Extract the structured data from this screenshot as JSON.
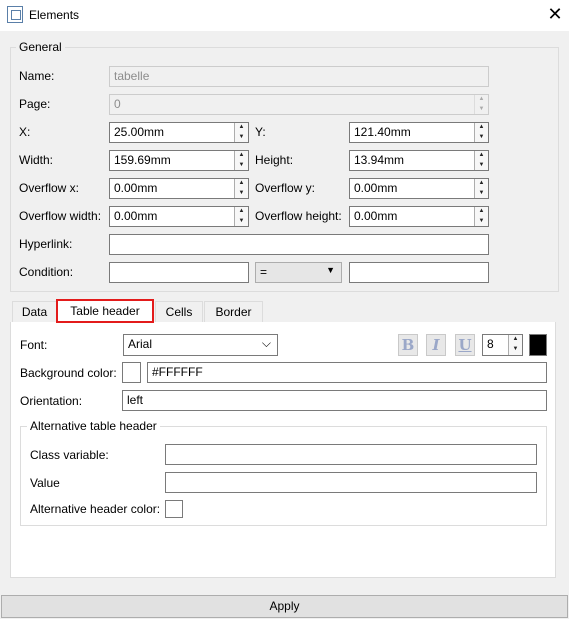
{
  "window": {
    "title": "Elements",
    "close_glyph": "✕",
    "icon": "window-app-icon"
  },
  "general": {
    "group_label": "General",
    "name": {
      "label": "Name:",
      "value": "tabelle"
    },
    "page": {
      "label": "Page:",
      "value": "0"
    },
    "x": {
      "label": "X:",
      "value": "25.00mm"
    },
    "y": {
      "label": "Y:",
      "value": "121.40mm"
    },
    "width": {
      "label": "Width:",
      "value": "159.69mm"
    },
    "height": {
      "label": "Height:",
      "value": "13.94mm"
    },
    "overflow_x": {
      "label": "Overflow x:",
      "value": "0.00mm"
    },
    "overflow_y": {
      "label": "Overflow y:",
      "value": "0.00mm"
    },
    "overflow_width": {
      "label": "Overflow width:",
      "value": "0.00mm"
    },
    "overflow_height": {
      "label": "Overflow height:",
      "value": "0.00mm"
    },
    "hyperlink": {
      "label": "Hyperlink:",
      "value": ""
    },
    "condition": {
      "label": "Condition:",
      "left_value": "",
      "operator": "=",
      "right_value": ""
    }
  },
  "tabs": [
    {
      "label": "Data",
      "active": false
    },
    {
      "label": "Table header",
      "active": true
    },
    {
      "label": "Cells",
      "active": false
    },
    {
      "label": "Border",
      "active": false
    }
  ],
  "table_header": {
    "font": {
      "label": "Font:",
      "value": "Arial",
      "size": "8",
      "color": "#000000"
    },
    "format_buttons": [
      {
        "glyph": "B",
        "name": "bold"
      },
      {
        "glyph": "I",
        "name": "italic"
      },
      {
        "glyph": "U",
        "name": "underline"
      }
    ],
    "background_color": {
      "label": "Background color:",
      "value": "#FFFFFF",
      "swatch": "#FFFFFF"
    },
    "orientation": {
      "label": "Orientation:",
      "value": "left"
    },
    "alternative": {
      "group_label": "Alternative table header",
      "class_variable": {
        "label": "Class variable:",
        "value": ""
      },
      "value": {
        "label": "Value",
        "value": ""
      },
      "alt_header_color": {
        "label": "Alternative header color:",
        "swatch": "#FFFFFF"
      }
    }
  },
  "apply_label": "Apply",
  "colors": {
    "active_tab_border": "#e31b1b",
    "dialog_bg": "#f0f0f0"
  }
}
